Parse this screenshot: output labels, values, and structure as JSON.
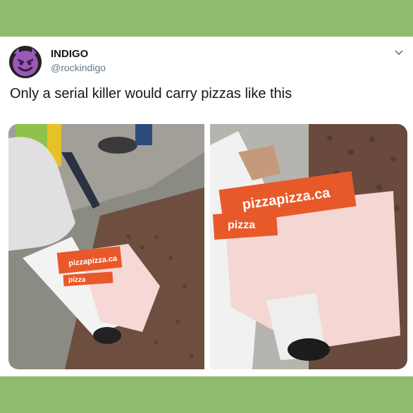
{
  "tweet": {
    "display_name": "INDIGO",
    "handle": "@rockindigo",
    "text": "Only a serial killer would carry pizzas like this",
    "avatar_icon": "smiling-devil-icon",
    "menu_icon": "chevron-down-icon"
  },
  "photos": {
    "left": {
      "box_text_1": "pizzapizza.ca",
      "box_text_2": "pizza"
    },
    "right": {
      "box_text_1": "pizzapizza.ca",
      "box_text_2": "pizza"
    }
  },
  "colors": {
    "frame": "#8fbc6f",
    "card": "#ffffff",
    "pizza_box": "#e8592a"
  }
}
